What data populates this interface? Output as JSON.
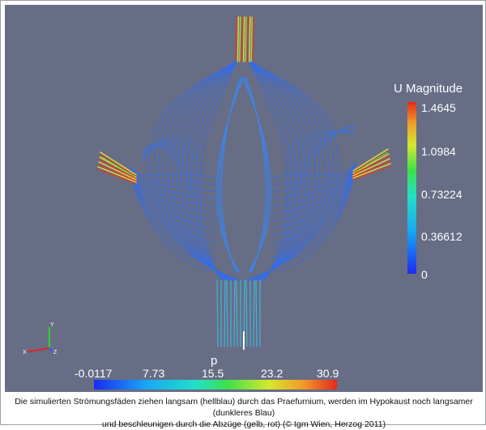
{
  "colorbars": {
    "velocity": {
      "title": "U Magnitude",
      "ticks": [
        "1.4645",
        "1.0984",
        "0.73224",
        "0.36612",
        "0"
      ]
    },
    "pressure": {
      "title": "p",
      "ticks": [
        "-0.0117",
        "7.73",
        "15.5",
        "23.2",
        "30.9"
      ]
    }
  },
  "axes_triad": {
    "x_label": "X",
    "y_label": "Y",
    "z_label": "Z"
  },
  "colors": {
    "background": "#676d85",
    "slow_flow": "#2d6cf5",
    "medium_flow": "#36c8f0",
    "fast_flow_yellow": "#e8e23a",
    "fast_flow_red": "#e53a1e"
  },
  "caption": {
    "line1": "Die simulierten Strömungsfäden ziehen langsam (hellblau) durch das Praefurnium, werden im Hypokaust noch  langsamer (dunkleres Blau)",
    "line2": "und beschleunigen durch die Abzüge (gelb, rot) (© tgm Wien, Herzog 2011)"
  }
}
